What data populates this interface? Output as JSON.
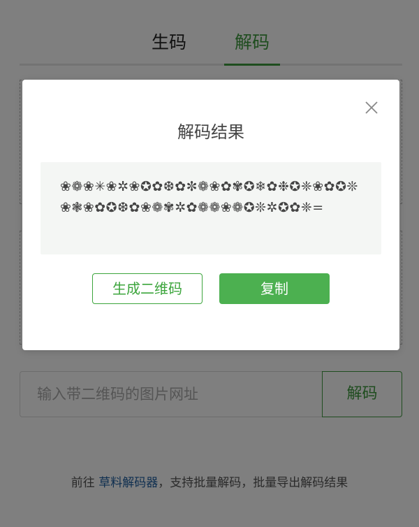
{
  "tabs": [
    {
      "label": "生码",
      "active": false
    },
    {
      "label": "解码",
      "active": true
    }
  ],
  "url_input": {
    "placeholder": "输入带二维码的图片网址"
  },
  "decode_button": {
    "label": "解码"
  },
  "footer": {
    "prefix": "前往 ",
    "link_text": "草料解码器",
    "suffix": "，支持批量解码，批量导出解码结果"
  },
  "modal": {
    "title": "解码结果",
    "result_text": "❀❁❀✳❀✲❀✪✿❆✿✼❁❀✿✾✪❄✿❉✪❈❀✿✪❊❀❃❀✿✪❆✿❀❁✾✲✿❁❁❀❁✪❊✲✪✿❈=",
    "generate_qr_label": "生成二维码",
    "copy_label": "复制"
  },
  "colors": {
    "accent": "#3e9a3e",
    "copy_bg": "#4cb050",
    "link": "#1f5fa0"
  },
  "icons": {
    "close": "close-icon"
  }
}
